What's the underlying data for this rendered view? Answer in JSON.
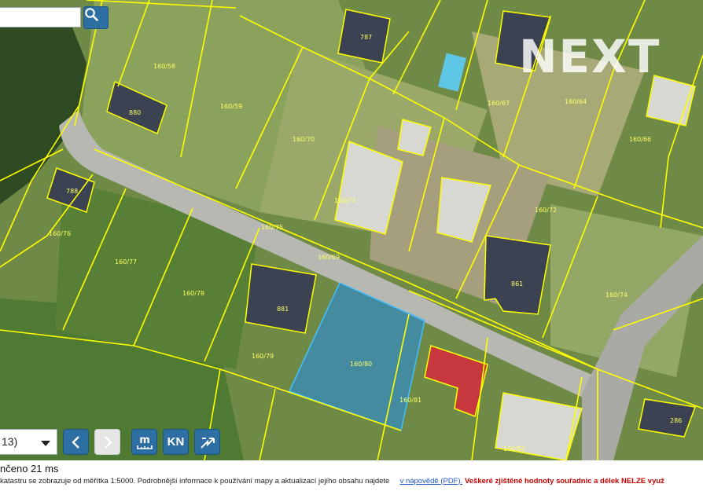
{
  "search": {
    "value": "",
    "placeholder": ""
  },
  "watermark": "NEXT",
  "map": {
    "highlight_color": "#2b8cd6",
    "boundary_color": "#ffff00",
    "parcels": [
      "160/58",
      "160/59",
      "160/70",
      "160/64",
      "160/66",
      "160/71",
      "160/72",
      "160/74",
      "160/75",
      "160/76",
      "160/77",
      "160/78",
      "160/79",
      "160/80",
      "160/81",
      "160/82",
      "160/69",
      "160/67"
    ],
    "buildings": [
      "787",
      "880",
      "788",
      "881",
      "861",
      "286"
    ]
  },
  "toolbar": {
    "scale_select_value": "13)",
    "prev_icon": "chevron-left-icon",
    "next_icon": "chevron-right-icon",
    "measure_label": "m",
    "kn_label": "KN",
    "share_icon": "share-icon"
  },
  "status": {
    "text": "nčeno 21 ms"
  },
  "info": {
    "text": "katastru se zobrazuje od měřítka 1:5000. Podrobnější informace k používání mapy a aktualizací jejího obsahu najdete",
    "link": "v nápovědě (PDF).",
    "warning": "Veškeré zjištěné hodnoty souřadnic a délek NELZE využ"
  }
}
